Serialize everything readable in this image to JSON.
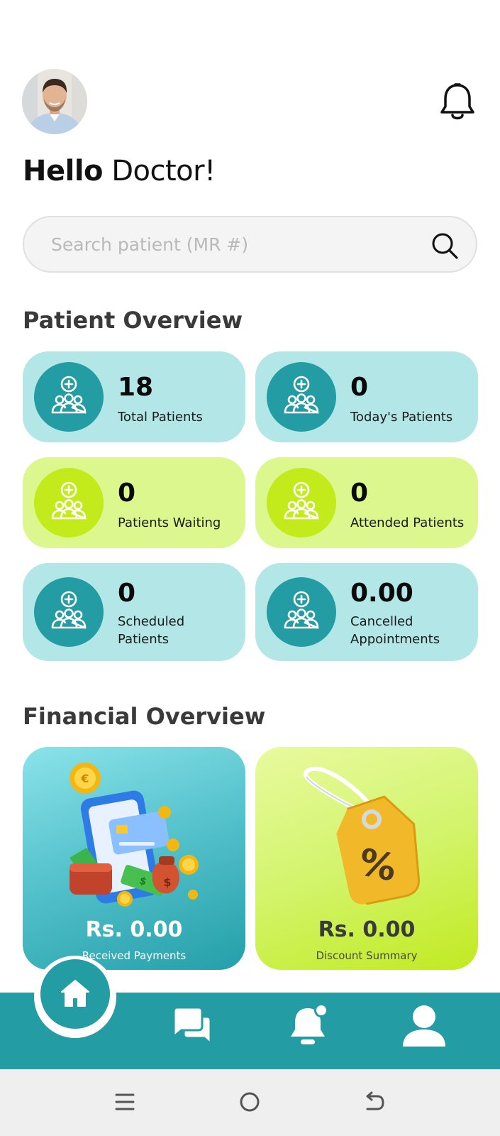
{
  "header": {
    "avatar_icon": "doctor-profile-photo",
    "notification_icon": "bell-icon"
  },
  "greeting": {
    "bold": "Hello",
    "rest": " Doctor!"
  },
  "search": {
    "placeholder": "Search patient (MR #)",
    "value": "",
    "icon": "search-icon"
  },
  "patient_overview": {
    "title": "Patient Overview",
    "cards": [
      {
        "value": "18",
        "label": "Total Patients",
        "color": "#b3e6e6",
        "icon": "patients-group-icon"
      },
      {
        "value": "0",
        "label": "Today's Patients",
        "color": "#b3e6e6",
        "icon": "patients-group-icon"
      },
      {
        "value": "0",
        "label": "Patients Waiting",
        "color": "#dcf78e",
        "icon": "patients-group-icon"
      },
      {
        "value": "0",
        "label": "Attended Patients",
        "color": "#dcf78e",
        "icon": "patients-group-icon"
      },
      {
        "value": "0",
        "label": "Scheduled Patients",
        "color": "#b3e6e6",
        "icon": "patients-group-icon"
      },
      {
        "value": "0.00",
        "label": "Cancelled Appointments",
        "color": "#b3e6e6",
        "icon": "patients-group-icon"
      }
    ]
  },
  "financial_overview": {
    "title": "Financial Overview",
    "received": {
      "amount": "Rs. 0.00",
      "label": "Received Payments",
      "icon": "payment-phone-coins-illustration"
    },
    "discount": {
      "amount": "Rs. 0.00",
      "label": "Discount Summary",
      "icon": "discount-tag-illustration"
    }
  },
  "bottom_nav": {
    "accent": "#239ca4",
    "items": [
      "home-icon",
      "chat-icon",
      "notifications-icon",
      "profile-icon"
    ]
  },
  "system_nav": {
    "items": [
      "recents-icon",
      "home-circle-icon",
      "back-icon"
    ]
  }
}
